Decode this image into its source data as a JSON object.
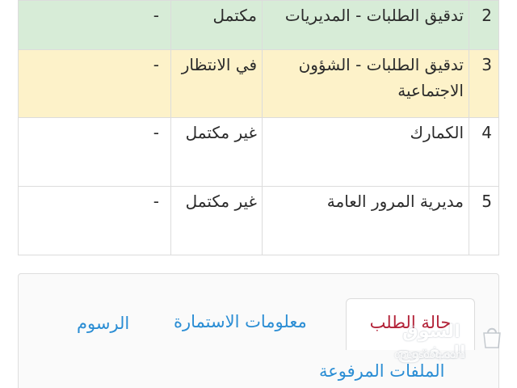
{
  "status_table": {
    "rows": [
      {
        "number": "2",
        "name": "تدقيق الطلبات - المديريات",
        "status": "مكتمل",
        "note": "-"
      },
      {
        "number": "3",
        "name": "تدقيق الطلبات - الشؤون الاجتماعية",
        "status": "في الانتظار",
        "note": "-"
      },
      {
        "number": "4",
        "name": "الكمارك",
        "status": "غير مكتمل",
        "note": "-"
      },
      {
        "number": "5",
        "name": "مديرية المرور العامة",
        "status": "غير مكتمل",
        "note": "-"
      }
    ]
  },
  "tabs": {
    "request_status": "حالة الطلب",
    "form_info": "معلومات الاستمارة",
    "fees": "الرسوم",
    "uploaded_files": "الملفات المرفوعة"
  },
  "watermark": {
    "brand": "السوق المفتوح",
    "site": "opensooq.com"
  },
  "colors": {
    "complete_row": "#d7ecd7",
    "pending_row": "#fdf2c9",
    "active_tab_text": "#b32339",
    "link_tab_text": "#2a8dd4"
  }
}
